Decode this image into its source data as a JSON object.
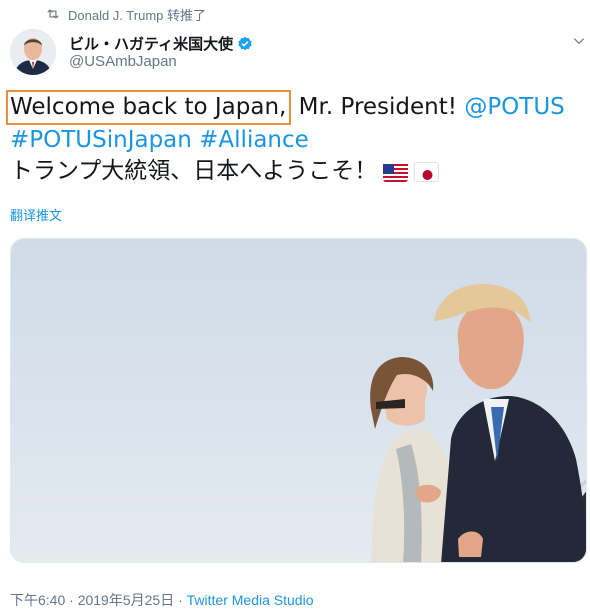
{
  "retweet": {
    "icon": "retweet-icon",
    "text": "Donald J. Trump 转推了"
  },
  "author": {
    "display_name": "ビル・ハガティ米国大使",
    "handle": "@USAmbJapan",
    "verified": true
  },
  "tweet": {
    "highlighted_text": "Welcome back to Japan,",
    "text_part2": " Mr. President! ",
    "mention": "@POTUS",
    "hashtag1": "#POTUSinJapan",
    "hashtag2": "#Alliance",
    "japanese_text": "トランプ大統領、日本へようこそ！",
    "flags": [
      "us-flag",
      "japan-flag"
    ]
  },
  "translate_label": "翻译推文",
  "timestamp": {
    "time": "下午6:40 · 2019年5月25日 · ",
    "source": "Twitter Media Studio"
  },
  "colors": {
    "link": "#1b95e0",
    "secondary": "#657786",
    "highlight_border": "#e8913c"
  }
}
